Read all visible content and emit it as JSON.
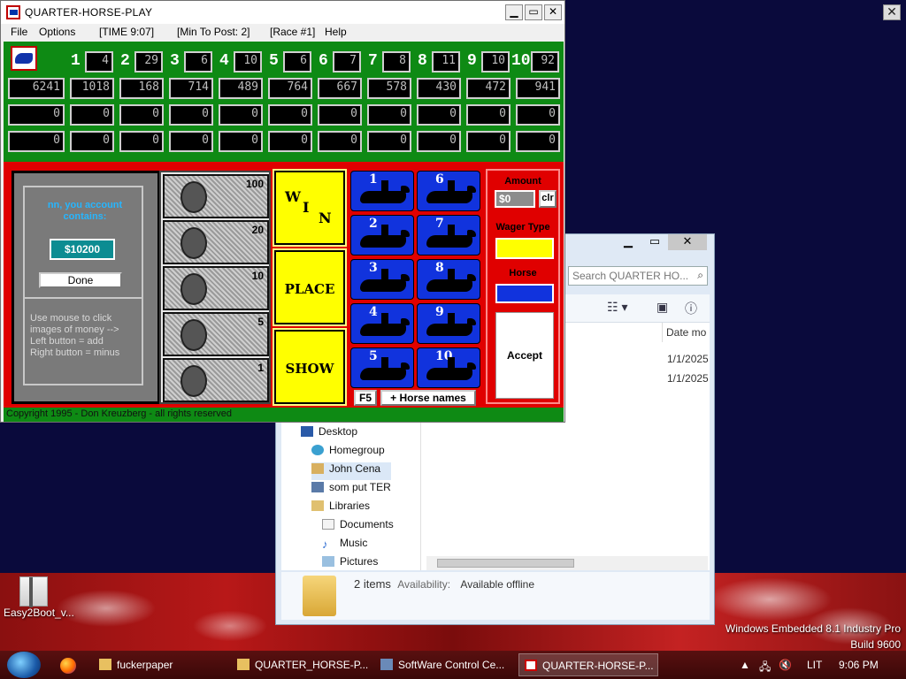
{
  "game": {
    "title": "QUARTER-HORSE-PLAY",
    "menu": [
      "File",
      "Options",
      "[TIME 9:07]",
      "[Min To Post: 2]",
      "[Race #1]",
      "Help"
    ],
    "odds": [
      "4",
      "29",
      "6",
      "10",
      "6",
      "7",
      "8",
      "11",
      "10",
      "92"
    ],
    "pool_row1": [
      "6241",
      "1018",
      "168",
      "714",
      "489",
      "764",
      "667",
      "578",
      "430",
      "472",
      "941"
    ],
    "pool_row2": [
      "0",
      "0",
      "0",
      "0",
      "0",
      "0",
      "0",
      "0",
      "0",
      "0",
      "0"
    ],
    "pool_row3": [
      "0",
      "0",
      "0",
      "0",
      "0",
      "0",
      "0",
      "0",
      "0",
      "0",
      "0"
    ],
    "account_label": "nn, you account contains:",
    "account_amount": "$10200",
    "done_label": "Done",
    "help_text": "Use mouse to click\nimages of money -->\nLeft button = add\nRight button = minus",
    "bills": [
      "100",
      "20",
      "10",
      "5",
      "1"
    ],
    "bet_types": {
      "win": "WIN",
      "place": "PLACE",
      "show": "SHOW"
    },
    "horses": [
      "1",
      "2",
      "3",
      "4",
      "5",
      "6",
      "7",
      "8",
      "9",
      "10"
    ],
    "f5_label": "F5",
    "horse_names_label": "+ Horse names",
    "amount_label": "Amount",
    "amount_value": "$0",
    "clr_label": "clr",
    "wager_type_label": "Wager Type",
    "horse_label": "Horse",
    "accept_label": "Accept",
    "copyright": "Copyright 1995 - Don Kreuzberg - all rights reserved",
    "colors": {
      "board_green": "#0e8a14",
      "board_red": "#e00000",
      "bet_yellow": "#ffff00",
      "horse_blue": "#1133dd"
    }
  },
  "explorer": {
    "search_placeholder": "Search QUARTER HO...",
    "column_date": "Date mo",
    "dates": [
      "1/1/2025",
      "1/1/2025"
    ],
    "nav": [
      "Desktop",
      "Homegroup",
      "John Cena",
      "som put TER",
      "Libraries",
      "Documents",
      "Music",
      "Pictures"
    ],
    "status_items": "2 items",
    "status_availability_label": "Availability:",
    "status_availability_value": "Available offline"
  },
  "desktop": {
    "icon_label": "Easy2Boot_v...",
    "watermark_line1": "Windows Embedded 8.1 Industry Pro",
    "watermark_line2": "Build 9600"
  },
  "taskbar": {
    "tasks": [
      "fuckerpaper",
      "QUARTER_HORSE-P...",
      "SoftWare Control Ce...",
      "QUARTER-HORSE-P..."
    ],
    "lang": "LIT",
    "clock": "9:06 PM"
  }
}
